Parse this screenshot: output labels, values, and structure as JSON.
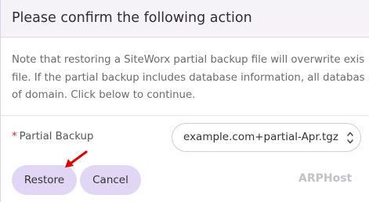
{
  "dialog": {
    "title": "Please confirm the following action",
    "message_lines": [
      "Note that restoring a SiteWorx partial backup file will overwrite exis",
      "file. If the partial backup includes database information, all databas",
      "of domain. Click below to continue."
    ]
  },
  "form": {
    "required_marker": "*",
    "partial_backup_label": "Partial Backup",
    "partial_backup_value": "example.com+partial-Apr.tgz"
  },
  "buttons": {
    "restore_label": "Restore",
    "cancel_label": "Cancel"
  },
  "annotation": {
    "arrow_color": "#e00000",
    "arrow_target": "restore-button"
  },
  "watermark": {
    "text": "ARPHost"
  },
  "colors": {
    "button_bg": "#e2d6f5",
    "header_bg": "#f5f2f8",
    "required": "#d0312d"
  },
  "icons": {
    "select_indicator": "up-down-chevron-icon",
    "annotation": "red-arrow-icon"
  }
}
